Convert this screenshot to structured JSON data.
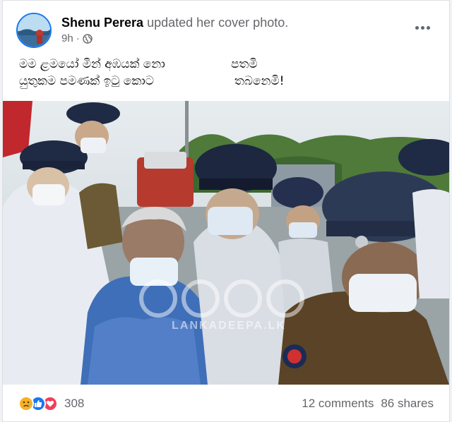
{
  "post": {
    "author_name": "Shenu Perera",
    "action_text": "updated her cover photo.",
    "time": "9h",
    "privacy_icon": "globe-icon",
    "more_icon": "more-options-icon",
    "caption_lines": [
      {
        "left": "මම ළමයෝ මින් අඹයක් නො",
        "right": "පතමි"
      },
      {
        "left": "යුතුකම පමණක් ඉටු කොට",
        "right": "තබනෙමි!"
      }
    ]
  },
  "photo": {
    "watermark_text": "LANKADEEPA.LK"
  },
  "footer": {
    "reaction_icons": [
      "sad-reaction-icon",
      "like-reaction-icon",
      "love-reaction-icon"
    ],
    "reaction_count": "308",
    "comments": "12 comments",
    "shares": "86 shares"
  },
  "colors": {
    "brand_blue": "#1877f2",
    "secondary_text": "#65676b",
    "uniform_blue": "#2d3a55",
    "uniform_khaki": "#5a4326"
  }
}
